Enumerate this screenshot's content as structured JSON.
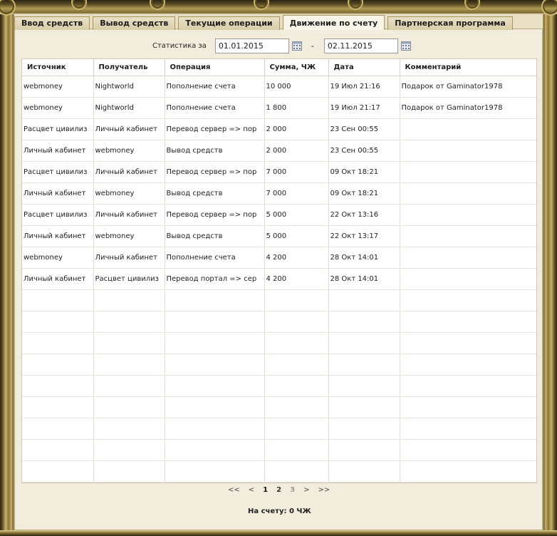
{
  "tabs": [
    {
      "label": "Ввод средств",
      "active": false
    },
    {
      "label": "Вывод средств",
      "active": false
    },
    {
      "label": "Текущие операции",
      "active": false
    },
    {
      "label": "Движение по счету",
      "active": true
    },
    {
      "label": "Партнерская программа",
      "active": false
    }
  ],
  "filter": {
    "label": "Статистика за",
    "date_from": "01.01.2015",
    "separator": "-",
    "date_to": "02.11.2015",
    "calendar_icon": "calendar-icon"
  },
  "table": {
    "columns": [
      "Источник",
      "Получатель",
      "Операция",
      "Сумма, ЧЖ",
      "Дата",
      "Комментарий"
    ],
    "rows": [
      [
        "webmoney",
        "Nightworld",
        "Пополнение счета",
        "10 000",
        "19 Июл 21:16",
        "Подарок от Gaminator1978"
      ],
      [
        "webmoney",
        "Nightworld",
        "Пополнение счета",
        "1 800",
        "19 Июл 21:17",
        "Подарок от Gaminator1978"
      ],
      [
        "Расцвет цивилиз",
        "Личный кабинет",
        "Перевод сервер => пор",
        "2 000",
        "23 Сен 00:55",
        ""
      ],
      [
        "Личный кабинет",
        "webmoney",
        "Вывод средств",
        "2 000",
        "23 Сен 00:55",
        ""
      ],
      [
        "Расцвет цивилиз",
        "Личный кабинет",
        "Перевод сервер => пор",
        "7 000",
        "09 Окт 18:21",
        ""
      ],
      [
        "Личный кабинет",
        "webmoney",
        "Вывод средств",
        "7 000",
        "09 Окт 18:21",
        ""
      ],
      [
        "Расцвет цивилиз",
        "Личный кабинет",
        "Перевод сервер => пор",
        "5 000",
        "22 Окт 13:16",
        ""
      ],
      [
        "Личный кабинет",
        "webmoney",
        "Вывод средств",
        "5 000",
        "22 Окт 13:17",
        ""
      ],
      [
        "webmoney",
        "Личный кабинет",
        "Пополнение счета",
        "4 200",
        "28 Окт 14:01",
        ""
      ],
      [
        "Личный кабинет",
        "Расцвет цивилиз",
        "Перевод портал => сер",
        "4 200",
        "28 Окт 14:01",
        ""
      ],
      [
        "",
        "",
        "",
        "",
        "",
        ""
      ],
      [
        "",
        "",
        "",
        "",
        "",
        ""
      ],
      [
        "",
        "",
        "",
        "",
        "",
        ""
      ],
      [
        "",
        "",
        "",
        "",
        "",
        ""
      ],
      [
        "",
        "",
        "",
        "",
        "",
        ""
      ],
      [
        "",
        "",
        "",
        "",
        "",
        ""
      ],
      [
        "",
        "",
        "",
        "",
        "",
        ""
      ],
      [
        "",
        "",
        "",
        "",
        "",
        ""
      ],
      [
        "",
        "",
        "",
        "",
        "",
        ""
      ]
    ]
  },
  "pager": {
    "first": "<<",
    "prev": "<",
    "pages": [
      {
        "label": "1",
        "state": "current"
      },
      {
        "label": "2",
        "state": "link"
      },
      {
        "label": "3",
        "state": "disabled"
      }
    ],
    "next": ">",
    "last": ">>"
  },
  "balance": "На счету: 0 ЧЖ"
}
